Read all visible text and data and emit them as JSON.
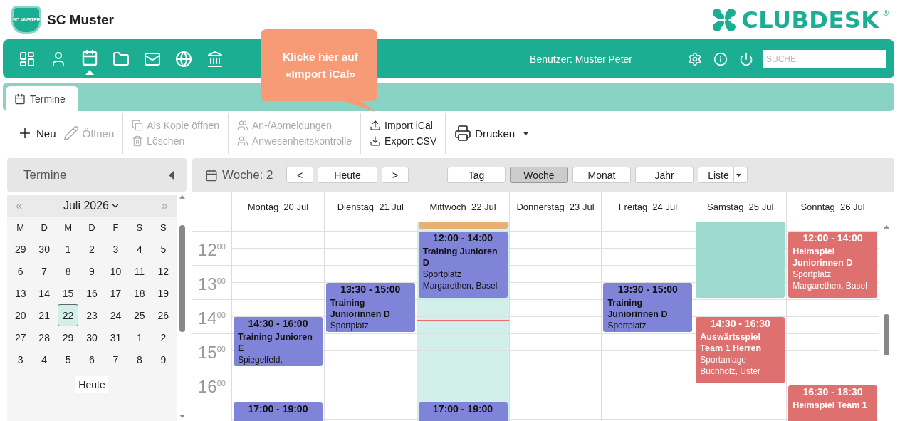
{
  "club": {
    "name": "SC Muster",
    "logo_text": "SC MUSTER"
  },
  "brand": {
    "name": "CLUBDESK",
    "mark": "®"
  },
  "nav": {
    "items": [
      {
        "kind": "dashboard",
        "selected": false
      },
      {
        "kind": "person",
        "selected": false
      },
      {
        "kind": "calendar",
        "selected": true
      },
      {
        "kind": "folder",
        "selected": false
      },
      {
        "kind": "mail",
        "selected": false
      },
      {
        "kind": "globe",
        "selected": false
      },
      {
        "kind": "bank",
        "selected": false
      }
    ],
    "user": "Benutzer: Muster Peter",
    "search": {
      "placeholder": "SUCHE"
    }
  },
  "callout": "Klicke hier auf «Import iCal»",
  "tabs": [
    {
      "label": "Termine",
      "selected": true
    }
  ],
  "toolbar": {
    "groups": [
      [
        {
          "kind": "plus",
          "label": "Neu",
          "disabled": false
        },
        {
          "kind": "pencil",
          "label": "Öffnen",
          "disabled": true
        }
      ],
      [
        {
          "kind": "copy",
          "label": "Als Kopie öffnen",
          "disabled": true
        },
        {
          "kind": "trash",
          "label": "Löschen",
          "disabled": true
        }
      ],
      [
        {
          "kind": "people",
          "label": "An-/Abmeldungen",
          "disabled": true
        },
        {
          "kind": "people",
          "label": "Anwesenheitskontrolle",
          "disabled": true
        }
      ],
      [
        {
          "kind": "upload",
          "label": "Import iCal",
          "disabled": false
        },
        {
          "kind": "download",
          "label": "Export CSV",
          "disabled": false
        }
      ],
      [
        {
          "kind": "printer",
          "label": "Drucken",
          "disabled": false,
          "dropdown": true
        }
      ]
    ]
  },
  "sidebar": {
    "title": "Termine",
    "mini_calendar": {
      "prev": "«",
      "next": "»",
      "month": "Juli 2026",
      "weekdays": [
        "M",
        "D",
        "M",
        "D",
        "F",
        "S",
        "S"
      ],
      "weeks": [
        [
          {
            "label": "29",
            "selected": false
          },
          {
            "label": "30",
            "selected": false
          },
          {
            "label": "1",
            "selected": false
          },
          {
            "label": "2",
            "selected": false
          },
          {
            "label": "3",
            "selected": false
          },
          {
            "label": "4",
            "selected": false
          },
          {
            "label": "5",
            "selected": false
          }
        ],
        [
          {
            "label": "6",
            "selected": false
          },
          {
            "label": "7",
            "selected": false
          },
          {
            "label": "8",
            "selected": false
          },
          {
            "label": "9",
            "selected": false
          },
          {
            "label": "10",
            "selected": false
          },
          {
            "label": "11",
            "selected": false
          },
          {
            "label": "12",
            "selected": false
          }
        ],
        [
          {
            "label": "13",
            "selected": false
          },
          {
            "label": "14",
            "selected": false
          },
          {
            "label": "15",
            "selected": false
          },
          {
            "label": "16",
            "selected": false
          },
          {
            "label": "17",
            "selected": false
          },
          {
            "label": "18",
            "selected": false
          },
          {
            "label": "19",
            "selected": false
          }
        ],
        [
          {
            "label": "20",
            "selected": false
          },
          {
            "label": "21",
            "selected": false
          },
          {
            "label": "22",
            "selected": true
          },
          {
            "label": "23",
            "selected": false
          },
          {
            "label": "24",
            "selected": false
          },
          {
            "label": "25",
            "selected": false
          },
          {
            "label": "26",
            "selected": false
          }
        ],
        [
          {
            "label": "27",
            "selected": false
          },
          {
            "label": "28",
            "selected": false
          },
          {
            "label": "29",
            "selected": false
          },
          {
            "label": "30",
            "selected": false
          },
          {
            "label": "31",
            "selected": false
          },
          {
            "label": "1",
            "selected": false
          },
          {
            "label": "2",
            "selected": false
          }
        ],
        [
          {
            "label": "3",
            "selected": false
          },
          {
            "label": "4",
            "selected": false
          },
          {
            "label": "5",
            "selected": false
          },
          {
            "label": "6",
            "selected": false
          },
          {
            "label": "7",
            "selected": false
          },
          {
            "label": "8",
            "selected": false
          },
          {
            "label": "9",
            "selected": false
          }
        ]
      ],
      "today_button": "Heute"
    }
  },
  "calendar": {
    "title": "Woche: 2",
    "nav": [
      "<",
      "Heute",
      ">"
    ],
    "views": [
      {
        "label": "Tag",
        "selected": false
      },
      {
        "label": "Woche",
        "selected": true
      },
      {
        "label": "Monat",
        "selected": false
      },
      {
        "label": "Jahr",
        "selected": false
      },
      {
        "label": "Liste",
        "selected": false,
        "dropdown": true
      }
    ],
    "hours": [
      {
        "hour": "12",
        "minutes": "00"
      },
      {
        "hour": "13",
        "minutes": "00"
      },
      {
        "hour": "14",
        "minutes": "00"
      },
      {
        "hour": "15",
        "minutes": "00"
      },
      {
        "hour": "16",
        "minutes": "00"
      }
    ],
    "days": [
      {
        "label": "Montag  20 Jul",
        "today": false,
        "events": [
          {
            "kind": "event",
            "time": "14:30 - 16:00",
            "title": "Training Junioren E",
            "place": "Spiegelfeld,",
            "color": "#8084d8"
          },
          {
            "kind": "event",
            "time": "17:00 - 19:00",
            "color": "#8084d8"
          }
        ]
      },
      {
        "label": "Dienstag  21 Jul",
        "today": false,
        "events": [
          {
            "kind": "event",
            "time": "13:30 - 15:00",
            "title": "Training Juniorinnen D",
            "place": "Sportplatz",
            "color": "#8084d8"
          }
        ]
      },
      {
        "label": "Mittwoch  22 Jul",
        "today": true,
        "events": [
          {
            "kind": "bar",
            "color": "#e9b071"
          },
          {
            "kind": "event",
            "time": "12:00 - 14:00",
            "title": "Training Junioren D",
            "place": "Sportplatz Margarethen, Basel",
            "color": "#8084d8"
          },
          {
            "kind": "event",
            "time": "17:00 - 19:00",
            "color": "#8084d8"
          }
        ]
      },
      {
        "label": "Donnerstag  23 Jul",
        "today": false
      },
      {
        "label": "Freitag  24 Jul",
        "today": false,
        "events": [
          {
            "kind": "event",
            "time": "13:30 - 15:00",
            "title": "Training Juniorinnen D",
            "place": "Sportplatz",
            "color": "#8084d8"
          }
        ]
      },
      {
        "label": "Samstag  25 Jul",
        "today": false,
        "events": [
          {
            "kind": "bar",
            "color": "#9dd9cf"
          },
          {
            "kind": "event",
            "time": "14:30 - 16:30",
            "title": "Auswärtsspiel Team 1 Herren",
            "place": "Sportanlage Buchholz, Uster",
            "color": "#de7070"
          }
        ]
      },
      {
        "label": "Sonntag  26 Jul",
        "today": false,
        "events": [
          {
            "kind": "event",
            "time": "12:00 - 14:00",
            "title": "Heimspiel Juniorinnen D",
            "place": "Sportplatz Margarethen, Basel",
            "color": "#de7070"
          },
          {
            "kind": "event",
            "time": "16:30 - 18:30",
            "title": "Heimspiel Team 1",
            "color": "#de7070"
          }
        ]
      }
    ]
  }
}
